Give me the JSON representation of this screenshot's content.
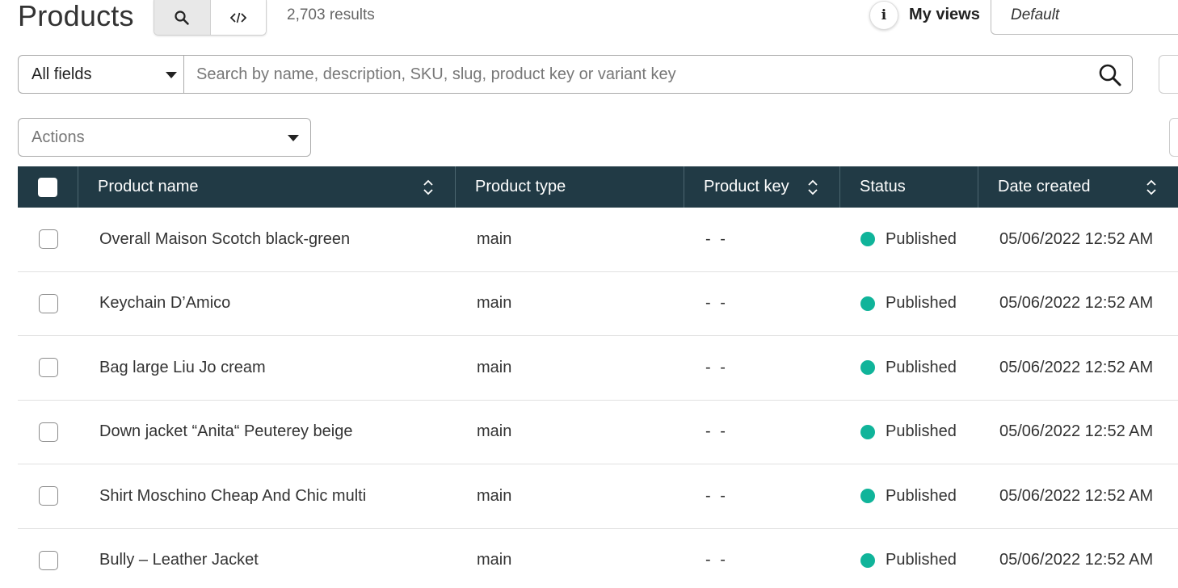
{
  "header": {
    "title": "Products",
    "results": "2,703 results",
    "info_label": "i",
    "my_views_label": "My views",
    "views_selected": "Default"
  },
  "search": {
    "field_selected": "All fields",
    "placeholder": "Search by name, description, SKU, slug, product key or variant key"
  },
  "actions": {
    "placeholder": "Actions"
  },
  "table": {
    "columns": [
      "Product name",
      "Product type",
      "Product key",
      "Status",
      "Date created"
    ],
    "rows": [
      {
        "name": "Overall Maison Scotch black-green",
        "type": "main",
        "key": "- -",
        "status": "Published",
        "date": "05/06/2022 12:52 AM"
      },
      {
        "name": "Keychain D’Amico",
        "type": "main",
        "key": "- -",
        "status": "Published",
        "date": "05/06/2022 12:52 AM"
      },
      {
        "name": "Bag large Liu Jo cream",
        "type": "main",
        "key": "- -",
        "status": "Published",
        "date": "05/06/2022 12:52 AM"
      },
      {
        "name": "Down jacket “Anita“ Peuterey beige",
        "type": "main",
        "key": "- -",
        "status": "Published",
        "date": "05/06/2022 12:52 AM"
      },
      {
        "name": "Shirt Moschino Cheap And Chic multi",
        "type": "main",
        "key": "- -",
        "status": "Published",
        "date": "05/06/2022 12:52 AM"
      },
      {
        "name": "Bully – Leather Jacket",
        "type": "main",
        "key": "- -",
        "status": "Published",
        "date": "05/06/2022 12:52 AM"
      }
    ]
  },
  "colors": {
    "header_bg": "#213a45",
    "status_published": "#10b49a"
  }
}
